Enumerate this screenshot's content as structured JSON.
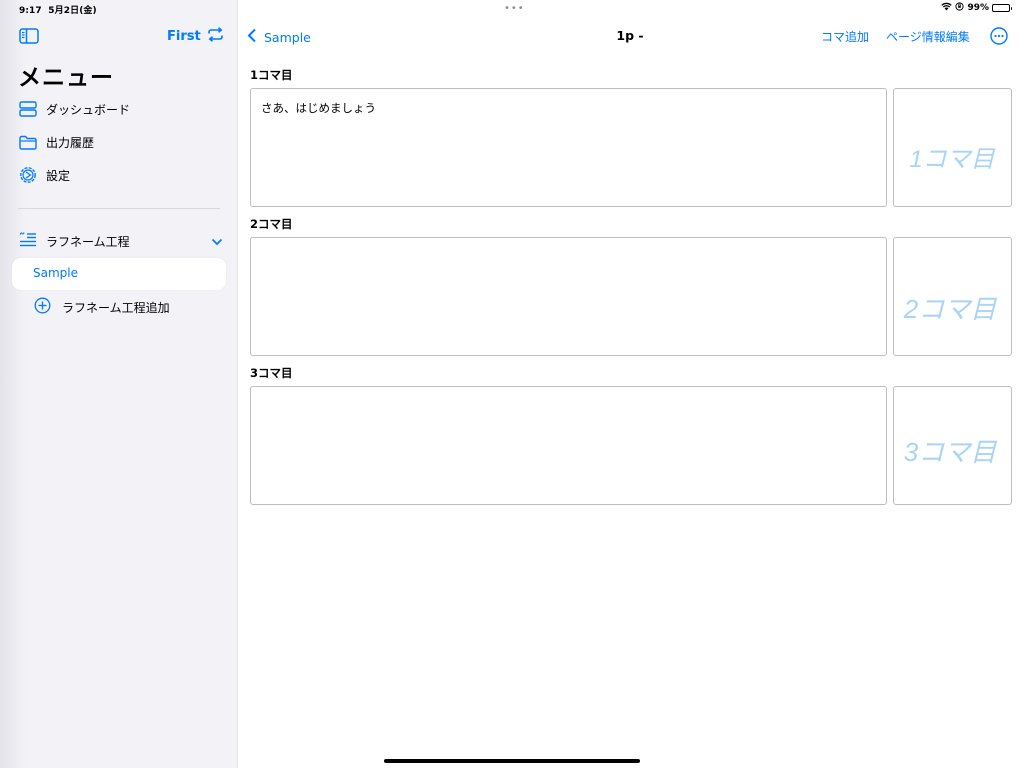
{
  "status": {
    "time": "9:17",
    "date": "5月2日(金)",
    "battery": "99%",
    "multitask": "•••"
  },
  "sidebar": {
    "first_label": "First",
    "title": "メニュー",
    "items": [
      {
        "label": "ダッシュボード",
        "icon": "dashboard-icon"
      },
      {
        "label": "出力履歴",
        "icon": "folder-icon"
      },
      {
        "label": "設定",
        "icon": "gear-icon"
      }
    ],
    "section": {
      "label": "ラフネーム工程",
      "icon": "list-icon"
    },
    "selected": "Sample",
    "add_label": "ラフネーム工程追加"
  },
  "nav": {
    "back_label": "Sample",
    "title": "1p -",
    "add_frame": "コマ追加",
    "edit_page": "ページ情報編集"
  },
  "frames": [
    {
      "label": "1コマ目",
      "text": "さあ、はじめましょう",
      "sketch": "1コマ目"
    },
    {
      "label": "2コマ目",
      "text": "",
      "sketch": "2コマ目"
    },
    {
      "label": "3コマ目",
      "text": "",
      "sketch": "3コマ目"
    }
  ],
  "colors": {
    "accent": "#007aff",
    "sidebar_bg": "#f2f2f7",
    "sketch": "#a9d4f5"
  }
}
